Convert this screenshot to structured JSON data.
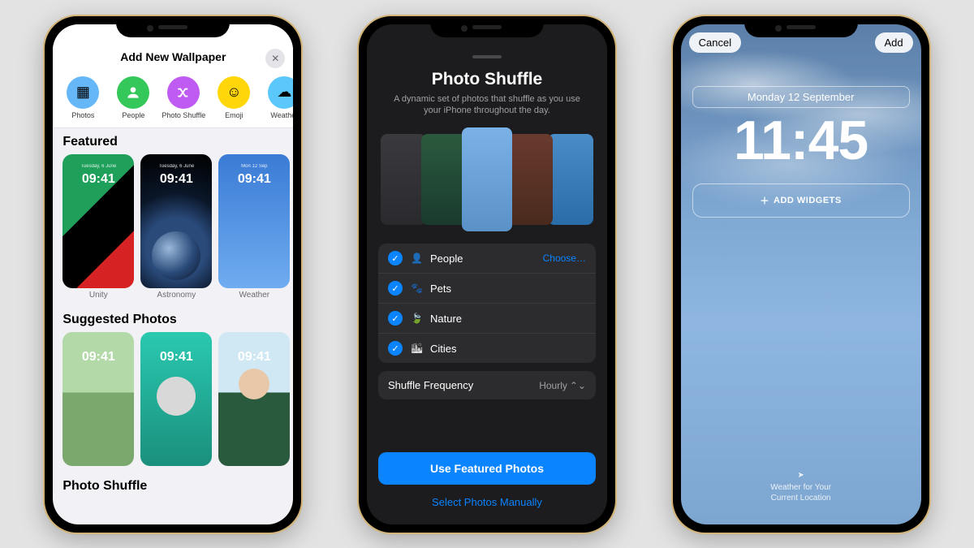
{
  "phone1": {
    "title": "Add New Wallpaper",
    "close_icon": "✕",
    "categories": [
      {
        "label": "Photos",
        "icon": "▦"
      },
      {
        "label": "People",
        "icon": "●"
      },
      {
        "label": "Photo Shuffle",
        "icon": "✕"
      },
      {
        "label": "Emoji",
        "icon": "☺"
      },
      {
        "label": "Weather",
        "icon": "☁"
      }
    ],
    "featured_title": "Featured",
    "featured": [
      {
        "label": "Unity",
        "time": "09:41"
      },
      {
        "label": "Astronomy",
        "time": "09:41"
      },
      {
        "label": "Weather",
        "time": "09:41"
      }
    ],
    "suggested_title": "Suggested Photos",
    "suggested": [
      {
        "time": "09:41"
      },
      {
        "time": "09:41"
      },
      {
        "time": "09:41"
      }
    ],
    "shuffle_title": "Photo Shuffle"
  },
  "phone2": {
    "title": "Photo Shuffle",
    "subtitle": "A dynamic set of photos that shuffle as you use your iPhone throughout the day.",
    "choose_label": "Choose…",
    "options": [
      {
        "label": "People",
        "icon": "👤"
      },
      {
        "label": "Pets",
        "icon": "🐾"
      },
      {
        "label": "Nature",
        "icon": "🍃"
      },
      {
        "label": "Cities",
        "icon": "🏙"
      }
    ],
    "freq_label": "Shuffle Frequency",
    "freq_value": "Hourly",
    "primary": "Use Featured Photos",
    "secondary": "Select Photos Manually"
  },
  "phone3": {
    "cancel": "Cancel",
    "add": "Add",
    "date": "Monday 12 September",
    "time": "11:45",
    "add_widgets": "ADD WIDGETS",
    "plus_icon": "+",
    "caption_line1": "Weather for Your",
    "caption_line2": "Current Location"
  }
}
